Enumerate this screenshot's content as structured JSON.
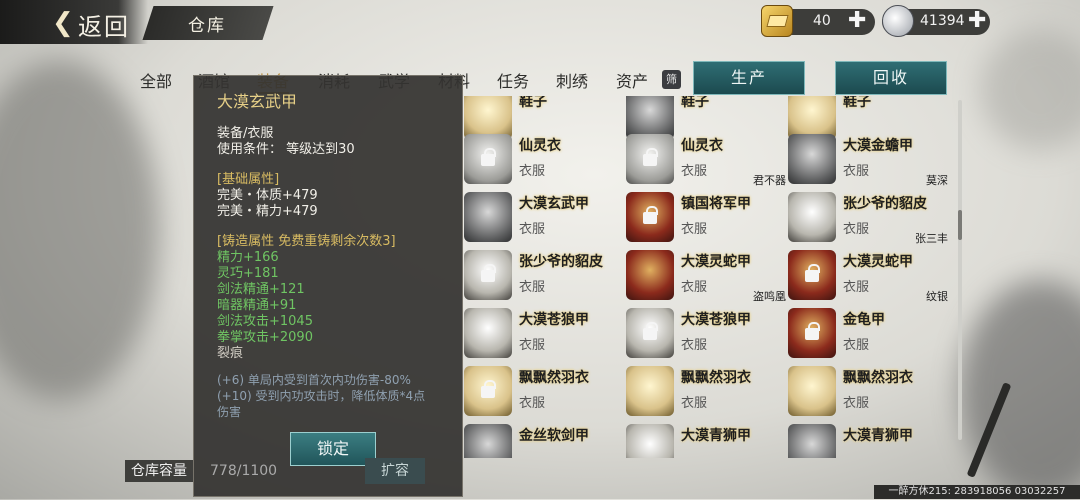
{
  "header": {
    "back_label": "返回",
    "title": "仓库",
    "gold": "40",
    "silver": "41394"
  },
  "tabs": [
    "全部",
    "酒馆",
    "装备",
    "消耗",
    "武学",
    "材料",
    "任务",
    "刺绣",
    "资产"
  ],
  "active_tab": "装备",
  "filter_badge": "筛",
  "buttons": {
    "produce": "生产",
    "recycle": "回收",
    "lock": "锁定",
    "expand": "扩容"
  },
  "grid": [
    {
      "name": "鞋子",
      "type": "",
      "owner": "",
      "locked": false,
      "style": "ic-gold"
    },
    {
      "name": "鞋子",
      "type": "",
      "owner": "",
      "locked": false,
      "style": "ic-grey"
    },
    {
      "name": "鞋子",
      "type": "",
      "owner": "",
      "locked": false,
      "style": "ic-gold"
    },
    {
      "name": "仙灵衣",
      "type": "衣服",
      "owner": "",
      "locked": true,
      "style": "ic-white"
    },
    {
      "name": "仙灵衣",
      "type": "衣服",
      "owner": "君不器",
      "locked": true,
      "style": "ic-white"
    },
    {
      "name": "大漠金蟾甲",
      "type": "衣服",
      "owner": "莫深",
      "locked": false,
      "style": "ic-grey"
    },
    {
      "name": "大漠玄武甲",
      "type": "衣服",
      "owner": "",
      "locked": false,
      "style": "ic-grey"
    },
    {
      "name": "镇国将军甲",
      "type": "衣服",
      "owner": "",
      "locked": true,
      "style": "ic-red"
    },
    {
      "name": "张少爷的貂皮",
      "type": "衣服",
      "owner": "张三丰",
      "locked": false,
      "style": "ic-fur"
    },
    {
      "name": "张少爷的貂皮",
      "type": "衣服",
      "owner": "",
      "locked": true,
      "style": "ic-fur"
    },
    {
      "name": "大漠灵蛇甲",
      "type": "衣服",
      "owner": "盗鸣凰",
      "locked": false,
      "style": "ic-red"
    },
    {
      "name": "大漠灵蛇甲",
      "type": "衣服",
      "owner": "纹银",
      "locked": true,
      "style": "ic-red"
    },
    {
      "name": "大漠苍狼甲",
      "type": "衣服",
      "owner": "",
      "locked": false,
      "style": "ic-fur"
    },
    {
      "name": "大漠苍狼甲",
      "type": "衣服",
      "owner": "",
      "locked": true,
      "style": "ic-fur"
    },
    {
      "name": "金龟甲",
      "type": "衣服",
      "owner": "",
      "locked": true,
      "style": "ic-red"
    },
    {
      "name": "飘飘然羽衣",
      "type": "衣服",
      "owner": "",
      "locked": true,
      "style": "ic-gold"
    },
    {
      "name": "飘飘然羽衣",
      "type": "衣服",
      "owner": "",
      "locked": false,
      "style": "ic-gold"
    },
    {
      "name": "飘飘然羽衣",
      "type": "衣服",
      "owner": "",
      "locked": false,
      "style": "ic-gold"
    },
    {
      "name": "金丝软剑甲",
      "type": "",
      "owner": "",
      "locked": false,
      "style": "ic-grey"
    },
    {
      "name": "大漠青狮甲",
      "type": "",
      "owner": "",
      "locked": false,
      "style": "ic-fur"
    },
    {
      "name": "大漠青狮甲",
      "type": "",
      "owner": "",
      "locked": false,
      "style": "ic-grey"
    }
  ],
  "tooltip": {
    "title": "大漠玄武甲",
    "category": "装备/衣服",
    "requirement": "使用条件：  等级达到30",
    "base_header": "[基础属性]",
    "base_stats": [
      "完美・体质+479",
      "完美・精力+479"
    ],
    "forge_header": "[铸造属性  免费重铸剩余次数3]",
    "forge_stats": [
      "精力+166",
      "灵巧+181",
      "剑法精通+121",
      "暗器精通+91",
      "剑法攻击+1045",
      "拳掌攻击+2090"
    ],
    "flaw": "裂痕",
    "effects": [
      "(+6) 单局内受到首次内功伤害-80%",
      "(+10) 受到内功攻击时，降低体质*4点",
      "伤害"
    ]
  },
  "storage": {
    "label": "仓库容量",
    "value": "778/1100"
  },
  "footer": "一醉方休215: 283918056  03032257"
}
